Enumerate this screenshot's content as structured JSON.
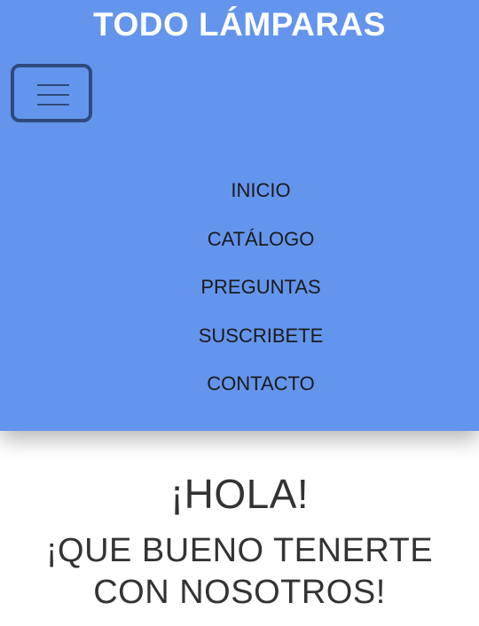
{
  "header": {
    "title": "TODO LÁMPARAS",
    "background": "#6495ed",
    "menu_toggle_icon": "hamburger-icon"
  },
  "nav": {
    "items": [
      {
        "label": "INICIO"
      },
      {
        "label": "CATÁLOGO"
      },
      {
        "label": "PREGUNTAS"
      },
      {
        "label": "SUSCRIBETE"
      },
      {
        "label": "CONTACTO"
      }
    ]
  },
  "welcome": {
    "heading": "¡HOLA!",
    "line1": "¡QUE BUENO TENERTE",
    "line2": "CON NOSOTROS!"
  }
}
